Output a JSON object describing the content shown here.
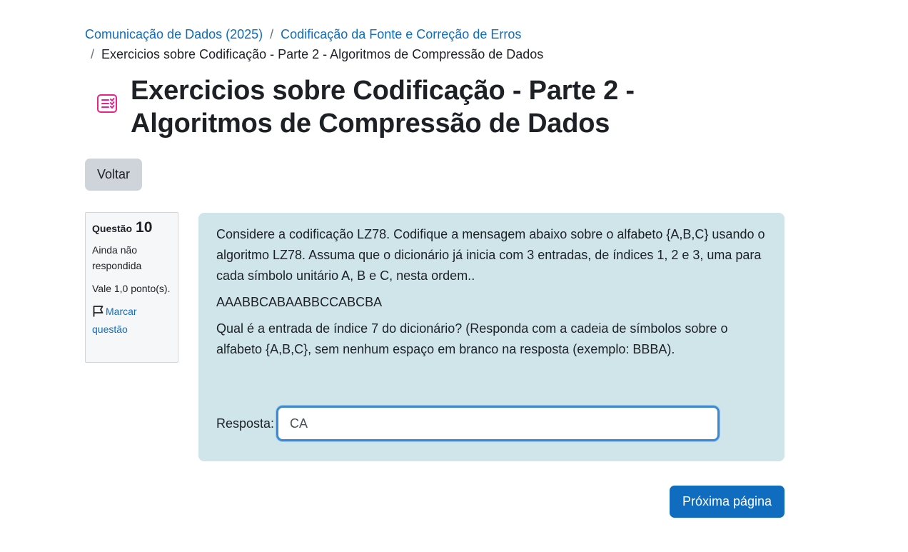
{
  "breadcrumb": {
    "course": "Comunicação de Dados (2025)",
    "section": "Codificação da Fonte e Correção de Erros",
    "current": "Exercicios sobre Codificação - Parte 2 - Algoritmos de Compressão de Dados",
    "separator": "/"
  },
  "page": {
    "title": "Exercicios sobre Codificação - Parte 2 - Algoritmos de Compressão de Dados",
    "icon": "quiz-icon",
    "accent_color": "#e8228a"
  },
  "back_button": "Voltar",
  "question_info": {
    "label": "Questão",
    "number": "10",
    "state": "Ainda não respondida",
    "grade": "Vale 1,0 ponto(s).",
    "flag_label": "Marcar questão"
  },
  "question": {
    "text1": "Considere a codificação LZ78. Codifique a mensagem abaixo sobre o alfabeto {A,B,C} usando o algoritmo LZ78. Assuma que o dicionário já inicia com 3 entradas, de índices 1, 2 e 3, uma para cada símbolo unitário A, B e C, nesta ordem..",
    "message": "AAABBCABAABBCCABCBA",
    "text2": "Qual é a entrada de índice 7 do dicionário? (Responda com a cadeia de símbolos sobre o alfabeto {A,B,C}, sem nenhum espaço em branco na resposta (exemplo: BBBA).",
    "answer_label": "Resposta:",
    "answer_value": "CA",
    "background_color": "#cfe5ea"
  },
  "next_button": "Próxima página",
  "colors": {
    "link": "#0f6cbf",
    "primary_button": "#0f6cbf",
    "secondary_button": "#ced4da"
  }
}
